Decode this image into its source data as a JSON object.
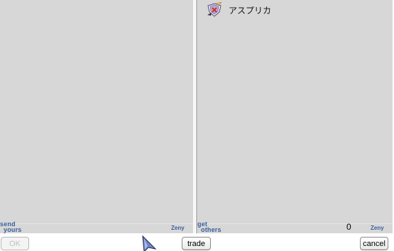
{
  "left_panel": {
    "label_line1": "send",
    "label_line2": "yours",
    "zeny_label": "Zeny"
  },
  "right_panel": {
    "item": {
      "name": "アスプリカ",
      "icon": "asprika-shield-icon"
    },
    "label_line1": "get",
    "label_line2": "others",
    "zeny_amount": "0",
    "zeny_label": "Zeny"
  },
  "buttons": {
    "ok": "OK",
    "trade": "trade",
    "cancel": "cancel"
  },
  "colors": {
    "panel_bg": "#d7d7d7",
    "label_blue": "#3a5f9f"
  }
}
